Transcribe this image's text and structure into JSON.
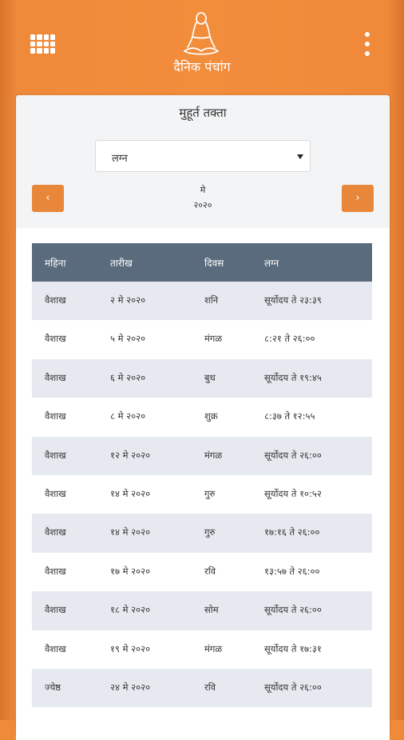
{
  "header": {
    "title": "दैनिक पंचांग",
    "apps_icon": "apps-grid-icon",
    "menu_icon": "more-vertical-icon",
    "logo_icon": "meditating-figure-logo"
  },
  "card": {
    "title": "मुहूर्त तक्ता",
    "select_value": "लग्न",
    "month": "मे",
    "year": "२०२०",
    "prev_label": "‹",
    "next_label": "›"
  },
  "table": {
    "columns": [
      "महिना",
      "तारीख",
      "दिवस",
      "लग्न"
    ],
    "rows": [
      [
        "वैशाख",
        "२ मे २०२०",
        "शनि",
        "सूर्योदय ते २३:३९"
      ],
      [
        "वैशाख",
        "५ मे २०२०",
        "मंगळ",
        "८:२१ ते २६:००"
      ],
      [
        "वैशाख",
        "६ मे २०२०",
        "बुध",
        "सूर्योदय ते १९:४५"
      ],
      [
        "वैशाख",
        "८ मे २०२०",
        "शुक्र",
        "८:३७ ते १२:५५"
      ],
      [
        "वैशाख",
        "१२ मे २०२०",
        "मंगळ",
        "सूर्योदय ते २६:००"
      ],
      [
        "वैशाख",
        "१४ मे २०२०",
        "गुरु",
        "सूर्योदय ते १०:५२"
      ],
      [
        "वैशाख",
        "१४ मे २०२०",
        "गुरु",
        "१७:१६ ते २६:००"
      ],
      [
        "वैशाख",
        "१७ मे २०२०",
        "रवि",
        "१३:५७ ते २६:००"
      ],
      [
        "वैशाख",
        "१८ मे २०२०",
        "सोम",
        "सूर्योदय ते २६:००"
      ],
      [
        "वैशाख",
        "१९ मे २०२०",
        "मंगळ",
        "सूर्योदय ते १७:३१"
      ],
      [
        "ज्येष्ठ",
        "२४ मे २०२०",
        "रवि",
        "सूर्योदय ते २६:००"
      ]
    ]
  },
  "colors": {
    "brand_orange": "#ef8a3a",
    "header_row": "#5a6b7d",
    "alt_row": "#e6eaf0"
  }
}
